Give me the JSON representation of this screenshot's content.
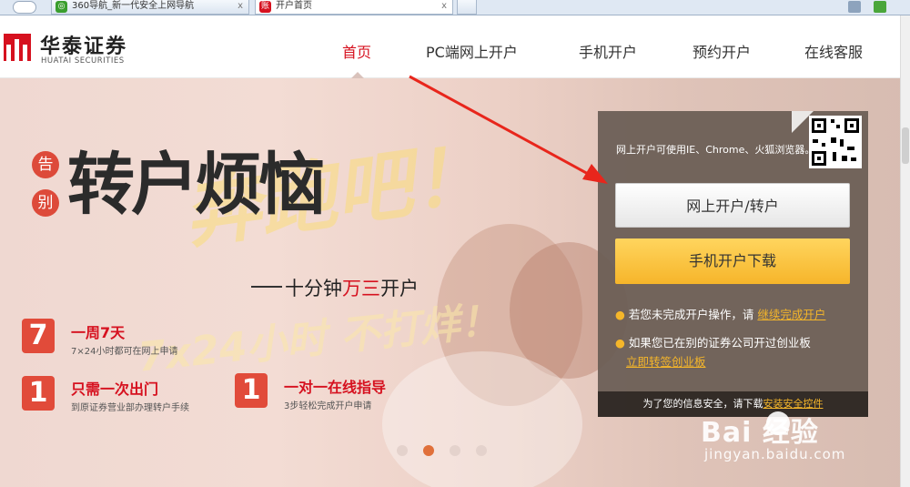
{
  "browser": {
    "tabs": [
      {
        "label": "360导航_新一代安全上网导航",
        "close": "x"
      },
      {
        "label": "开户首页",
        "close": "x"
      }
    ],
    "tab_icon_2": "账"
  },
  "header": {
    "logo_cn": "华泰证券",
    "logo_en": "HUATAI SECURITIES",
    "nav": [
      "首页",
      "PC端网上开户",
      "手机开户",
      "预约开户",
      "在线客服"
    ]
  },
  "banner": {
    "gao": "告",
    "bie": "别",
    "headline": "转户烦恼",
    "watermark_1": "奔跑吧！",
    "watermark_2": "7x24小时 不打烊！",
    "sub_slogan_pre": "十分钟",
    "sub_slogan_hl": "万三",
    "sub_slogan_post": "开户",
    "features": [
      {
        "num": "7",
        "title": "一周7天",
        "desc": "7×24小时都可在网上申请"
      },
      {
        "num": "1",
        "title": "只需一次出门",
        "desc": "到原证券营业部办理转户手续"
      },
      {
        "num": "1",
        "title": "一对一在线指导",
        "desc": "3步轻松完成开户申请"
      }
    ]
  },
  "panel": {
    "browser_tip": "网上开户可使用IE、Chrome、火狐浏览器。",
    "btn_online": "网上开户/转户",
    "btn_mobile": "手机开户下载",
    "note1_text": "若您未完成开户操作，请",
    "note1_link": "继续完成开户",
    "note2_text": "如果您已在别的证券公司开过创业板",
    "note2_link": "立即转签创业板",
    "footer_text": "为了您的信息安全，请下载",
    "footer_link": "安装安全控件",
    "bullet": "●"
  },
  "watermark": {
    "brand": "Bai  经验",
    "url": "jingyan.baidu.com"
  },
  "colors": {
    "brand_red": "#d6111f",
    "button_yellow": "#f6b52a",
    "panel_bg": "#695c54",
    "link_orange": "#f5b62a"
  }
}
